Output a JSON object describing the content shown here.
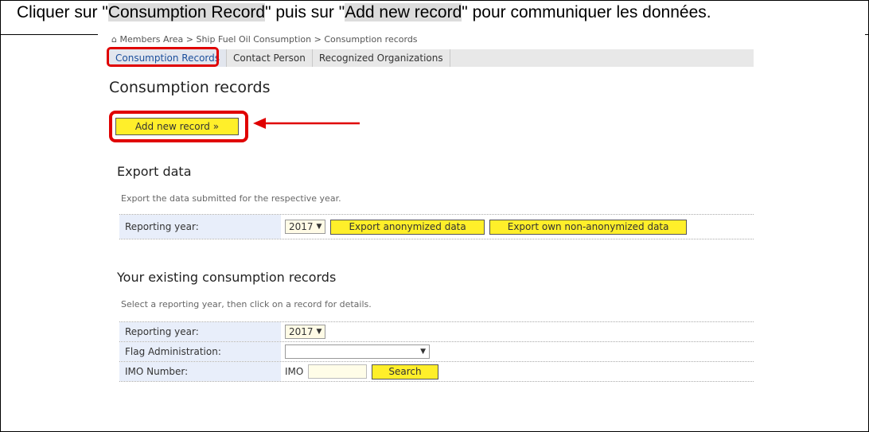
{
  "banner": {
    "part1": "Cliquer sur \"",
    "link1": "Consumption Record",
    "part2": "\" puis sur \"",
    "link2": "Add new record",
    "part3": "\" pour communiquer les données."
  },
  "breadcrumb": {
    "home_icon": "⌂",
    "text": "Members Area > Ship Fuel Oil Consumption > Consumption records"
  },
  "tabs": [
    {
      "label": "Consumption Records"
    },
    {
      "label": "Contact Person"
    },
    {
      "label": "Recognized Organizations"
    }
  ],
  "page_title": "Consumption records",
  "add_button": "Add new record »",
  "export": {
    "title": "Export data",
    "description": "Export the data submitted for the respective year.",
    "year_label": "Reporting year:",
    "year_value": "2017",
    "btn_anon": "Export anonymized data",
    "btn_own": "Export own non-anonymized data"
  },
  "existing": {
    "title": "Your existing consumption records",
    "description": "Select a reporting year, then click on a record for details.",
    "year_label": "Reporting year:",
    "year_value": "2017",
    "flag_label": "Flag Administration:",
    "flag_value": "",
    "imo_label": "IMO Number:",
    "imo_prefix": "IMO",
    "imo_value": "",
    "search_button": "Search"
  },
  "colors": {
    "highlight": "#e00000",
    "button_yellow": "#ffef2a",
    "label_bg": "#e8eefa"
  },
  "icons": {
    "caret": "▼",
    "arrow": "arrow-left"
  }
}
